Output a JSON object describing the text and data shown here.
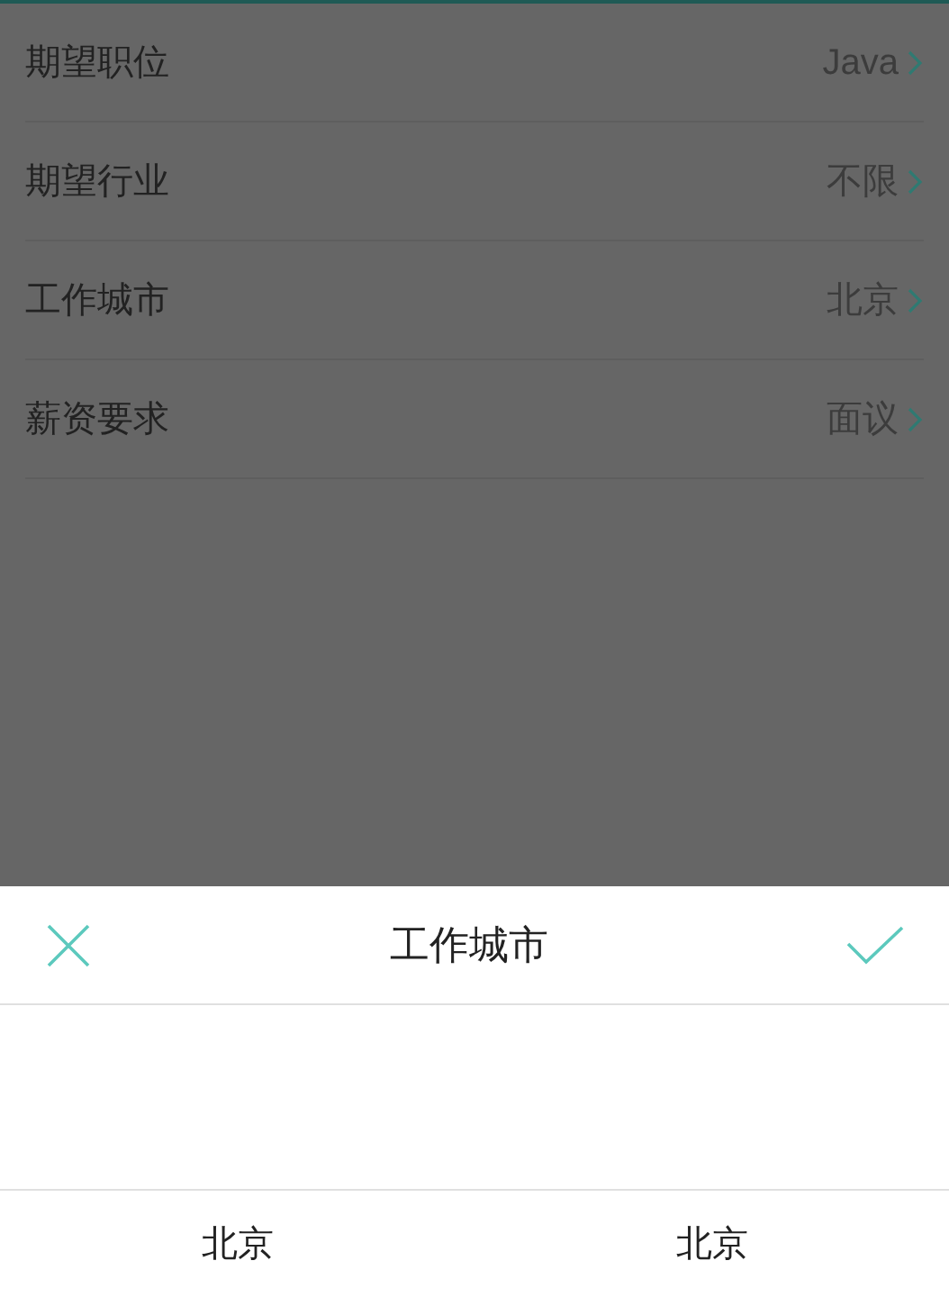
{
  "settings": [
    {
      "label": "期望职位",
      "value": "Java"
    },
    {
      "label": "期望行业",
      "value": "不限"
    },
    {
      "label": "工作城市",
      "value": "北京"
    },
    {
      "label": "薪资要求",
      "value": "面议"
    }
  ],
  "sheet": {
    "title": "工作城市"
  },
  "picker_columns": [
    {
      "value": "北京"
    },
    {
      "value": "北京"
    }
  ]
}
